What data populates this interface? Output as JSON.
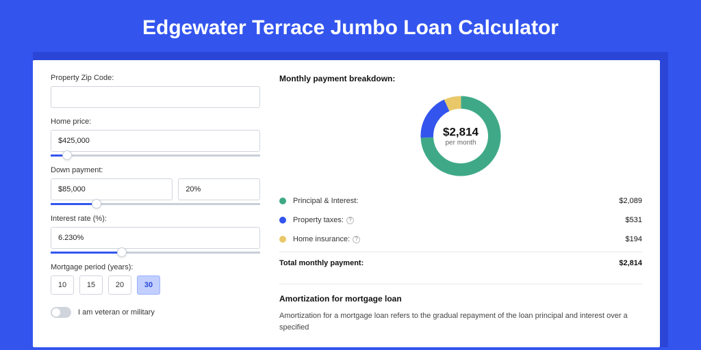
{
  "title": "Edgewater Terrace Jumbo Loan Calculator",
  "colors": {
    "principal": "#3fa987",
    "taxes": "#3355ee",
    "insurance": "#e9c86a"
  },
  "form": {
    "zip": {
      "label": "Property Zip Code:",
      "value": ""
    },
    "home_price": {
      "label": "Home price:",
      "value": "$425,000",
      "slider_pct": 8
    },
    "down_payment": {
      "label": "Down payment:",
      "amount": "$85,000",
      "percent": "20%",
      "slider_pct": 22
    },
    "interest": {
      "label": "Interest rate (%):",
      "value": "6.230%",
      "slider_pct": 34
    },
    "period": {
      "label": "Mortgage period (years):",
      "options": [
        "10",
        "15",
        "20",
        "30"
      ],
      "selected": "30"
    },
    "veteran": {
      "label": "I am veteran or military",
      "checked": false
    }
  },
  "breakdown": {
    "title": "Monthly payment breakdown:",
    "center_amount": "$2,814",
    "center_sub": "per month",
    "rows": [
      {
        "key": "principal",
        "label": "Principal & Interest:",
        "value": "$2,089",
        "info": false
      },
      {
        "key": "taxes",
        "label": "Property taxes:",
        "value": "$531",
        "info": true
      },
      {
        "key": "insurance",
        "label": "Home insurance:",
        "value": "$194",
        "info": true
      }
    ],
    "total_label": "Total monthly payment:",
    "total_value": "$2,814"
  },
  "chart_data": {
    "type": "pie",
    "title": "Monthly payment breakdown",
    "categories": [
      "Principal & Interest",
      "Property taxes",
      "Home insurance"
    ],
    "values": [
      2089,
      531,
      194
    ],
    "total": 2814,
    "colors": [
      "#3fa987",
      "#3355ee",
      "#e9c86a"
    ]
  },
  "amortization": {
    "title": "Amortization for mortgage loan",
    "text": "Amortization for a mortgage loan refers to the gradual repayment of the loan principal and interest over a specified"
  }
}
